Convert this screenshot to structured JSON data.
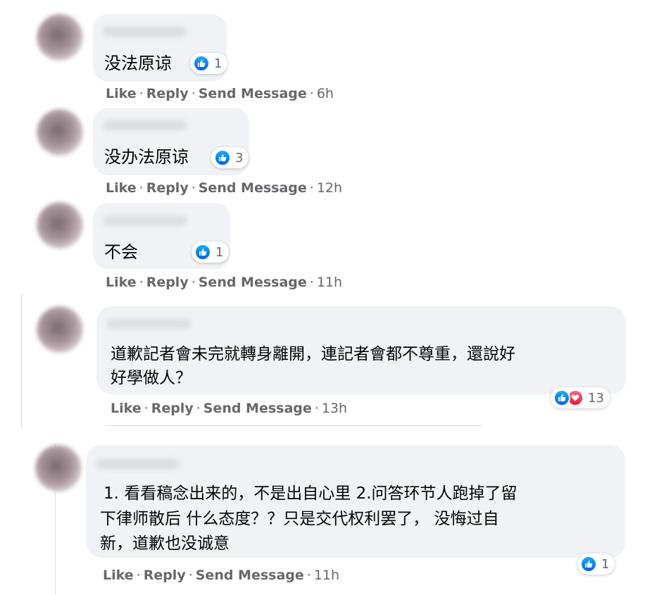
{
  "comments": [
    {
      "text": "没法原谅",
      "reactions": {
        "count": "1",
        "icons": [
          "like-icon"
        ]
      },
      "actions": {
        "like": "Like",
        "reply": "Reply",
        "send": "Send Message",
        "time": "6h"
      }
    },
    {
      "text": "没办法原谅",
      "reactions": {
        "count": "3",
        "icons": [
          "like-icon"
        ]
      },
      "actions": {
        "like": "Like",
        "reply": "Reply",
        "send": "Send Message",
        "time": "12h"
      }
    },
    {
      "text": "不会",
      "reactions": {
        "count": "1",
        "icons": [
          "like-icon"
        ]
      },
      "actions": {
        "like": "Like",
        "reply": "Reply",
        "send": "Send Message",
        "time": "11h"
      }
    },
    {
      "text_lines": [
        "道歉記者會未完就轉身離開，連記者會都不尊重，還說好",
        "好學做人？"
      ],
      "reactions": {
        "count": "13",
        "icons": [
          "like-icon",
          "heart-icon"
        ]
      },
      "actions": {
        "like": "Like",
        "reply": "Reply",
        "send": "Send Message",
        "time": "13h"
      }
    },
    {
      "text_lines": [
        "1. 看看稿念出来的，不是出自心里 2.问答环节人跑掉了留",
        "下律师散后 什么态度？？只是交代权利罢了， 没悔过自",
        "新，道歉也没诚意"
      ],
      "reactions": {
        "count": "1",
        "icons": [
          "like-icon"
        ]
      },
      "actions": {
        "like": "Like",
        "reply": "Reply",
        "send": "Send Message",
        "time": "11h"
      }
    }
  ],
  "colors": {
    "bubble": "#f0f2f5",
    "action_text": "#65676b",
    "like_blue": "#1877f2",
    "love_red": "#f33e58"
  },
  "separator": "·"
}
